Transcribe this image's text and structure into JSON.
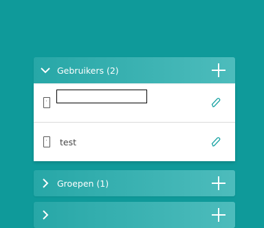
{
  "users_section": {
    "title": "Gebruikers (2)",
    "expanded": true,
    "items": [
      {
        "name": ""
      },
      {
        "name": "test"
      }
    ]
  },
  "groups_section": {
    "title": "Groepen (1)",
    "expanded": false
  },
  "next_section": {
    "title": ""
  },
  "colors": {
    "background": "#0f9a9a",
    "header_gradient_start": "#27a7a7",
    "header_gradient_end": "#4dbcbc",
    "accent": "#19a3a3"
  },
  "icons": {
    "expand": "chevron-down-icon",
    "collapse": "chevron-right-icon",
    "add": "plus-icon",
    "device": "phone-icon",
    "edit": "pencil-icon"
  }
}
